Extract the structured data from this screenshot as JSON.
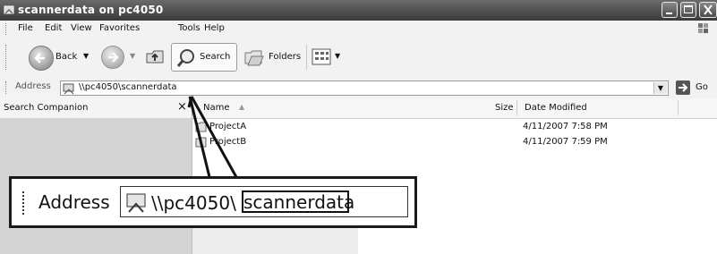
{
  "window": {
    "title": "scannerdata on pc4050"
  },
  "menu": {
    "items": [
      "File",
      "Edit",
      "View",
      "Favorites",
      "Tools",
      "Help"
    ]
  },
  "toolbar": {
    "back_label": "Back",
    "search_label": "Search",
    "folders_label": "Folders"
  },
  "address": {
    "label": "Address",
    "path": "\\\\pc4050\\scannerdata",
    "go_label": "Go"
  },
  "left_pane": {
    "title": "Search Companion",
    "close_glyph": "×"
  },
  "list": {
    "columns": {
      "name": "Name",
      "size": "Size",
      "date": "Date Modified"
    },
    "rows": [
      {
        "name": "ProjectA",
        "date": "4/11/2007 7:58 PM"
      },
      {
        "name": "ProjectB",
        "date": "4/11/2007 7:59 PM"
      }
    ]
  },
  "callout": {
    "label": "Address",
    "path_prefix": "\\\\pc4050\\",
    "path_highlight": "scannerdata"
  },
  "colors": {
    "titlebar": "#4a4a4a",
    "chrome": "#f2f2f2",
    "left_pane": "#d4d4d4"
  }
}
